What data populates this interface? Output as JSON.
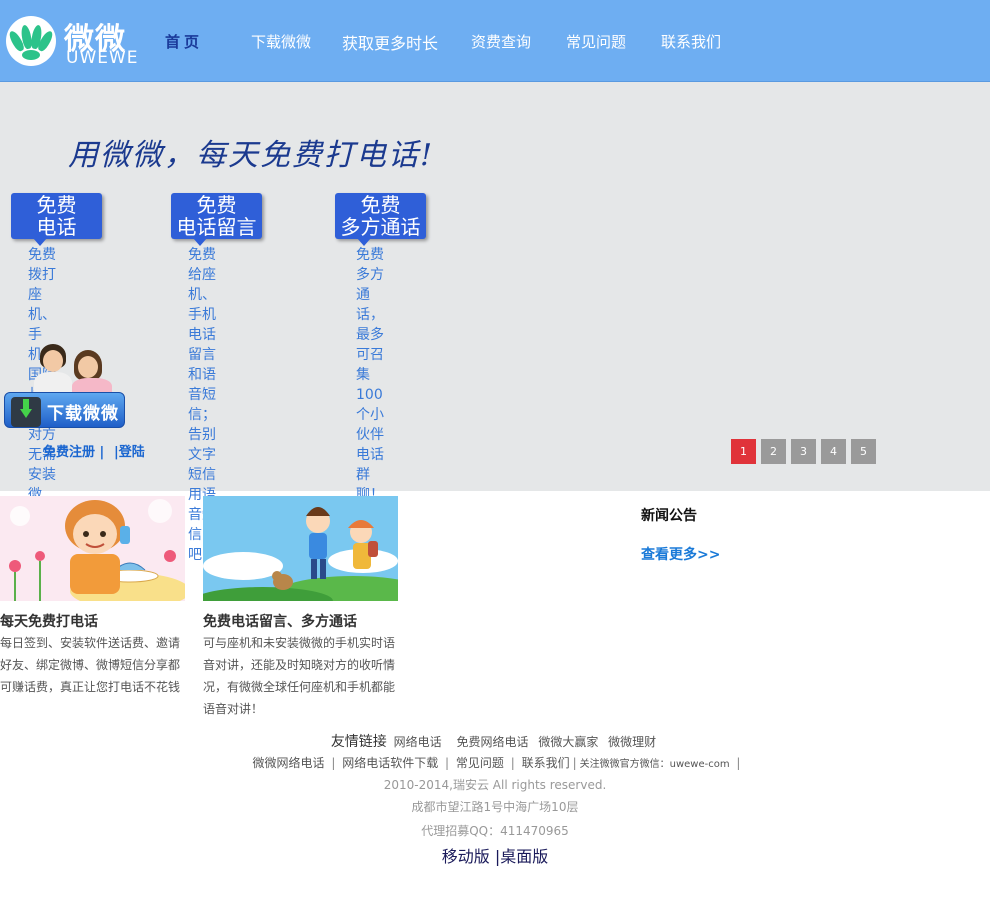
{
  "colors": {
    "header_bg": "#6eaef2",
    "banner_bg": "#e5e7e8",
    "tag_blue": "#2f5fd8",
    "desc_blue": "#3a7ad8",
    "pager_active": "#e0333a",
    "pager_inactive": "#9a9a9a",
    "link_blue": "#1a66d0"
  },
  "logo": {
    "cn": "微微",
    "en": "UWEWE",
    "icon": "logo-icon"
  },
  "nav": {
    "items": [
      {
        "label": "首页",
        "active": true
      },
      {
        "label": "下载微微"
      },
      {
        "label": "获取更多时长"
      },
      {
        "label": "资费查询"
      },
      {
        "label": "常见问题"
      },
      {
        "label": "联系我们"
      }
    ]
  },
  "banner": {
    "slogan": "用微微，每天免费打电话!",
    "features": [
      {
        "tag_line1": "免费",
        "tag_line2": "电话",
        "desc": "免费拨打座机、\n手机、国际长途，\n对方无需安装微微！"
      },
      {
        "tag_line1": "免费",
        "tag_line2": "电话留言",
        "desc": "免费给座机、手机\n电话留言和语音短信；\n告别文字短信\n用语音短信吧！"
      },
      {
        "tag_line1": "免费",
        "tag_line2": "多方通话",
        "desc": "免费多方通话，\n最多可召集100个小伙伴\n电话群聊！"
      }
    ],
    "download_label": "下载微微",
    "download_icon": "download-arrow-icon",
    "register_label": "免费注册",
    "login_label": "登陆",
    "pager": [
      "1",
      "2",
      "3",
      "4",
      "5"
    ],
    "pager_active": 0
  },
  "cards": [
    {
      "title": "每天免费打电话",
      "text": "每日签到、安装软件送话费、邀请\n好友、绑定微博、微博短信分享都\n可赚话费，真正让您打电话不花钱"
    },
    {
      "title": "免费电话留言、多方通话",
      "text": "可与座机和未安装微微的手机实时语\n音对讲，还能及时知晓对方的收听情\n况，有微微全球任何座机和手机都能\n语音对讲！"
    }
  ],
  "news": {
    "title": "新闻公告",
    "more": "查看更多>>"
  },
  "footer": {
    "friend_links_label": "友情链接",
    "friend_links": [
      "网络电话",
      "免费网络电话",
      "微微大赢家",
      "微微理财"
    ],
    "nav_links": [
      "微微网络电话",
      "网络电话软件下载",
      "常见问题",
      "联系我们",
      "关注微微官方微信：uwewe-com"
    ],
    "copyright": "2010-2014,瑞安云  All rights reserved.",
    "address": "成都市望江路1号中海广场10层",
    "qq": "代理招募QQ：411470965",
    "mobile": "移动版",
    "desktop": "桌面版"
  }
}
